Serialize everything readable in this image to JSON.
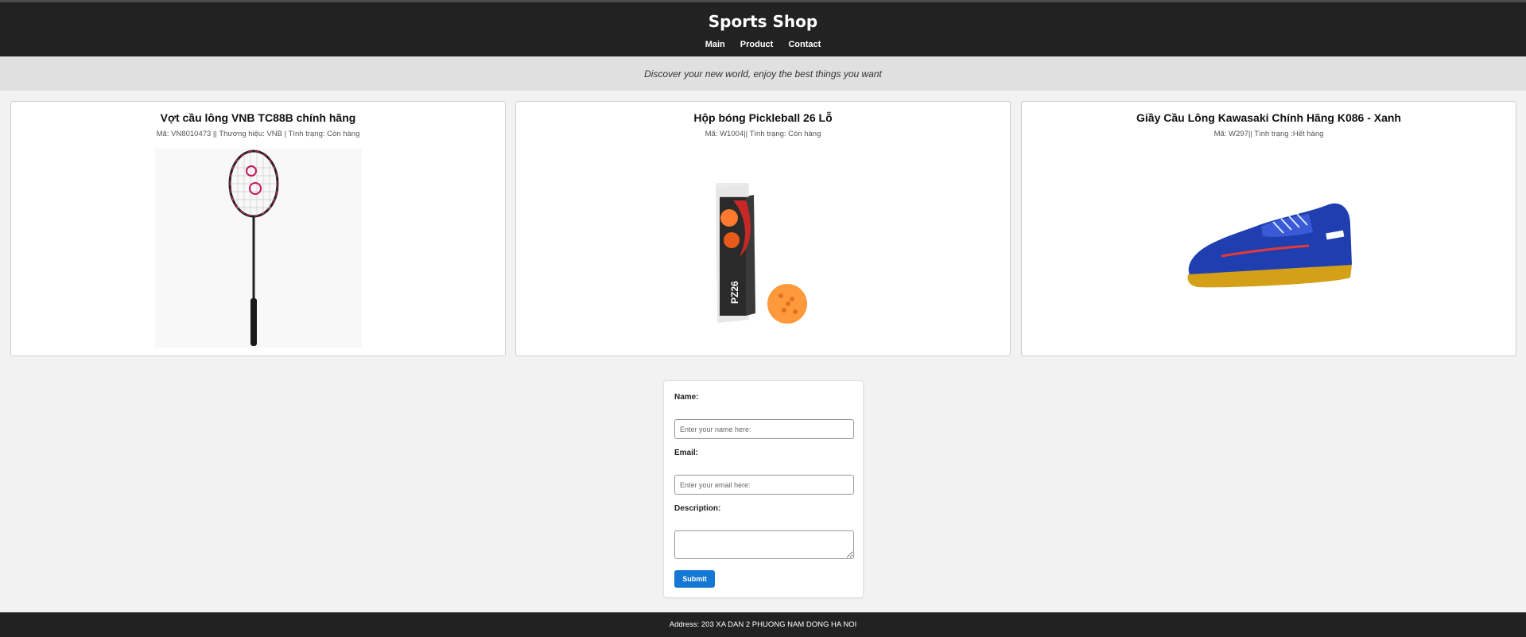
{
  "header": {
    "title": "Sports Shop",
    "nav": [
      "Main",
      "Product",
      "Contact"
    ]
  },
  "tagline": "Discover your new world, enjoy the best things you want",
  "products": [
    {
      "title": "Vợt cầu lông VNB TC88B chính hãng",
      "meta": "Mã: VN8010473 || Thương hiệu: VNB | Tình trạng: Còn hàng",
      "image_icon": "badminton-racket-image"
    },
    {
      "title": "Hộp bóng Pickleball 26 Lỗ",
      "meta": "Mã: W1004|| Tình trạng: Còn hàng",
      "image_icon": "pickleball-box-image",
      "box_label": "PZ26"
    },
    {
      "title": "Giầy Cầu Lông Kawasaki Chính Hãng K086 - Xanh",
      "meta": "Mã: W297|| Tình trạng :Hết hàng",
      "image_icon": "badminton-shoe-image"
    }
  ],
  "form": {
    "name_label": "Name:",
    "name_placeholder": "Enter your name here:",
    "email_label": "Email:",
    "email_placeholder": "Enter your email here:",
    "description_label": "Description:",
    "submit_label": "Submit"
  },
  "footer": {
    "address": "Address: 203 XA DAN 2 PHUONG NAM DONG HA NOI"
  },
  "colors": {
    "header_bg": "#222222",
    "tagline_bg": "#e0e0e0",
    "page_bg": "#f2f2f2",
    "submit_bg": "#1477d4"
  }
}
